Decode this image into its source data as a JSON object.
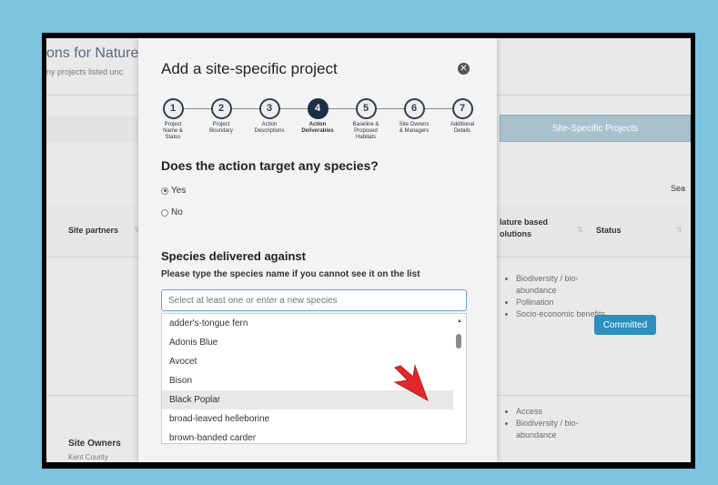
{
  "background": {
    "title": "ons for Nature",
    "subtitle": "ny projects listed unc",
    "active_tab": "Site-Specific Projects",
    "search_label": "Sea",
    "columns": {
      "site_partners": "Site partners",
      "nature_based": "lature based\nolutions",
      "status": "Status"
    },
    "row1_list": [
      "Biodiversity / bio-abundance",
      "Pollination",
      "Socio-economic benefits"
    ],
    "row1_status": "Committed",
    "row2_list": [
      "Access",
      "Biodiversity / bio-abundance"
    ],
    "row2_owner": "Site Owners",
    "row2_owner_sub": "Kent County"
  },
  "modal": {
    "title": "Add a site-specific project",
    "close_icon": "close-icon",
    "steps": [
      {
        "num": "1",
        "label": "Project\nName &\nStatus"
      },
      {
        "num": "2",
        "label": "Project\nBoundary"
      },
      {
        "num": "3",
        "label": "Action\nDescriptions"
      },
      {
        "num": "4",
        "label": "Action\nDeliverables",
        "active": true
      },
      {
        "num": "5",
        "label": "Baseline &\nProposed\nHabitats"
      },
      {
        "num": "6",
        "label": "Site Owners\n& Managers"
      },
      {
        "num": "7",
        "label": "Additional\nDetails"
      }
    ],
    "question": "Does the action target any species?",
    "yes_label": "Yes",
    "no_label": "No",
    "selected": "Yes",
    "species_title": "Species delivered against",
    "species_hint": "Please type the species name if you cannot see it on the list",
    "species_placeholder": "Select at least one or enter a new species",
    "options": [
      "adder's-tongue fern",
      "Adonis Blue",
      "Avocet",
      "Bison",
      "Black Poplar",
      "broad-leaved helleborine",
      "brown-banded carder"
    ],
    "highlighted_option": "Black Poplar"
  },
  "colors": {
    "accent": "#2c8fbe",
    "step_active": "#1d2f47",
    "cursor": "#e0282a",
    "backdrop": "#7cc3e0"
  }
}
